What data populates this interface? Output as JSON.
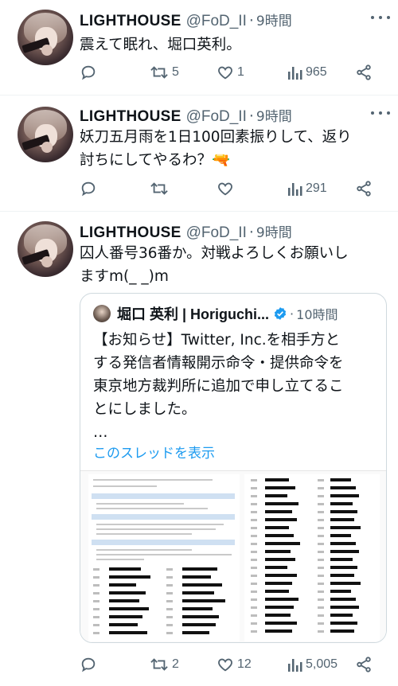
{
  "tweets": [
    {
      "name": "LIGHTHOUSE",
      "handle": "@FoD_II",
      "dot": "·",
      "time": "9時間",
      "lines": [
        "震えて眠れ、堀口英利。"
      ],
      "replies": "",
      "retweets": "5",
      "likes": "1",
      "views": "965"
    },
    {
      "name": "LIGHTHOUSE",
      "handle": "@FoD_II",
      "dot": "·",
      "time": "9時間",
      "lines": [
        "妖刀五月雨を1日100回素振りして、返り",
        "討ちにしてやるわ？🔫"
      ],
      "replies": "",
      "retweets": "",
      "likes": "",
      "views": "291"
    },
    {
      "name": "LIGHTHOUSE",
      "handle": "@FoD_II",
      "dot": "·",
      "time": "9時間",
      "lines": [
        "囚人番号36番か。対戦よろしくお願いし",
        "ますm(_ _)m"
      ],
      "replies": "",
      "retweets": "2",
      "likes": "12",
      "views": "5,005"
    }
  ],
  "quote": {
    "name": "堀口 英利 | Horiguchi...",
    "dot": "·",
    "time": "10時間",
    "lines": [
      "【お知らせ】Twitter, Inc.を相手方と",
      "する発信者情報開示命令・提供命令を",
      "東京地方裁判所に追加で申し立てるこ",
      "とにしました。"
    ],
    "ellipsis": "…",
    "thread_link": "このスレッドを表示"
  },
  "colors": {
    "text": "#0f1419",
    "muted": "#536471",
    "link": "#1d9bf0",
    "border": "#cfd9de"
  },
  "icons": [
    "more-icon",
    "reply-icon",
    "retweet-icon",
    "like-icon",
    "views-icon",
    "share-icon",
    "verified-icon"
  ]
}
